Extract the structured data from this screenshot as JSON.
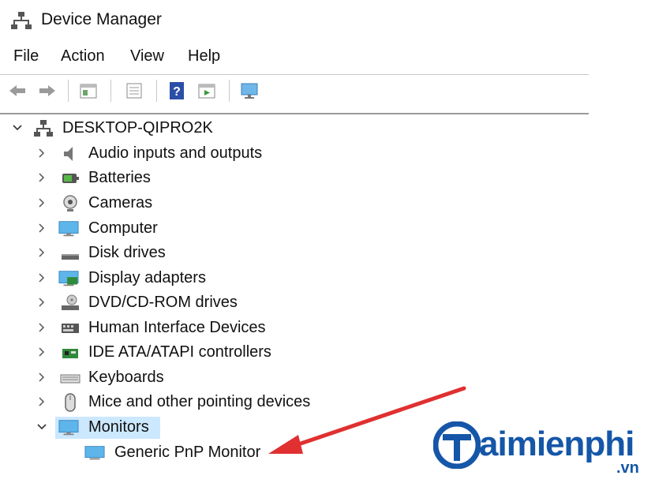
{
  "window": {
    "title": "Device Manager"
  },
  "menu": [
    "File",
    "Action",
    "View",
    "Help"
  ],
  "toolbar": {
    "buttons": [
      "back-icon",
      "forward-icon",
      "show-hide-tree-icon",
      "properties-icon",
      "help-icon",
      "run-icon",
      "monitor-scan-icon"
    ]
  },
  "tree": {
    "root": "DESKTOP-QIPRO2K",
    "categories": [
      "Audio inputs and outputs",
      "Batteries",
      "Cameras",
      "Computer",
      "Disk drives",
      "Display adapters",
      "DVD/CD-ROM drives",
      "Human Interface Devices",
      "IDE ATA/ATAPI controllers",
      "Keyboards",
      "Mice and other pointing devices",
      "Monitors"
    ],
    "expanded_category": "Monitors",
    "child": "Generic PnP Monitor"
  },
  "watermark": {
    "brand": "aimienphi",
    "suffix": ".vn"
  },
  "colors": {
    "selection": "#cce8ff",
    "arrow": "#e03030",
    "brand": "#1556a8"
  }
}
